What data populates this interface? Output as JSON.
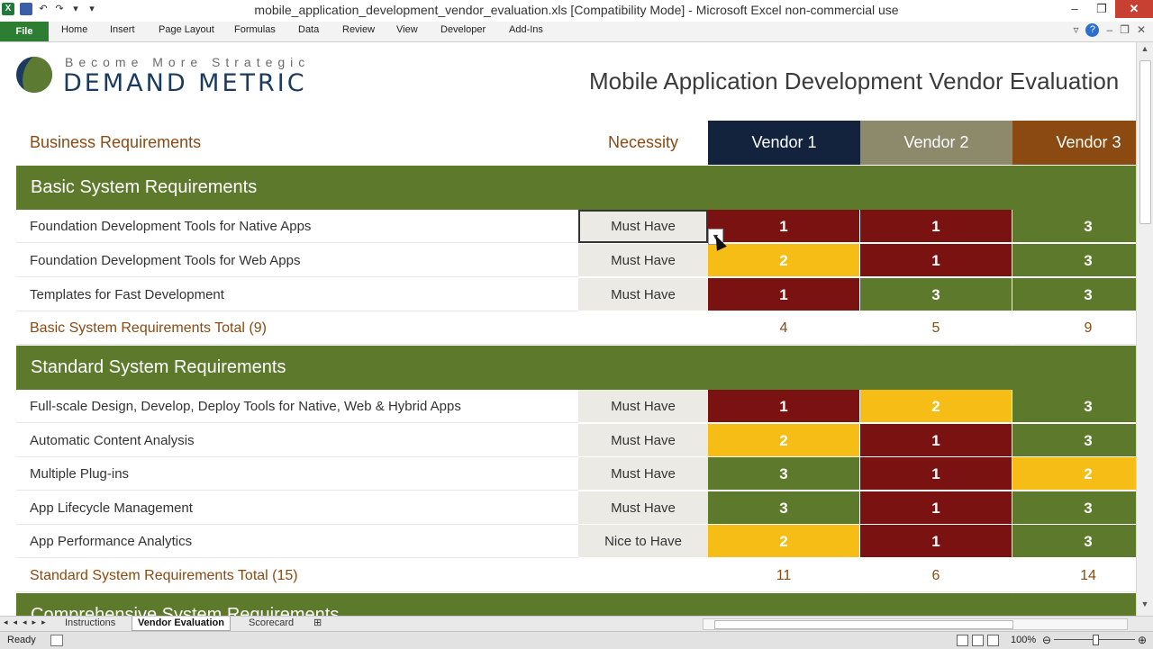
{
  "window": {
    "title": "mobile_application_development_vendor_evaluation.xls  [Compatibility Mode]  -  Microsoft Excel non-commercial use",
    "controls": {
      "minimize": "–",
      "restore": "❐",
      "close": "✕"
    }
  },
  "ribbon": {
    "file_label": "File",
    "tabs": [
      "Home",
      "Insert",
      "Page Layout",
      "Formulas",
      "Data",
      "Review",
      "View",
      "Developer",
      "Add-Ins"
    ]
  },
  "logo": {
    "tagline": "Become More Strategic",
    "name": "DEMAND METRIC"
  },
  "sheet_title": "Mobile Application Development Vendor Evaluation",
  "headers": {
    "requirements": "Business Requirements",
    "necessity": "Necessity",
    "vendors": [
      "Vendor 1",
      "Vendor 2",
      "Vendor 3"
    ]
  },
  "sections": [
    {
      "title": "Basic System Requirements",
      "rows": [
        {
          "req": "Foundation Development Tools for Native Apps",
          "necessity": "Must Have",
          "scores": [
            "1",
            "1",
            "3"
          ]
        },
        {
          "req": "Foundation Development Tools for Web Apps",
          "necessity": "Must Have",
          "scores": [
            "2",
            "1",
            "3"
          ]
        },
        {
          "req": "Templates for Fast Development",
          "necessity": "Must Have",
          "scores": [
            "1",
            "3",
            "3"
          ]
        }
      ],
      "total_label": "Basic System Requirements Total (9)",
      "totals": [
        "4",
        "5",
        "9"
      ]
    },
    {
      "title": "Standard System Requirements",
      "rows": [
        {
          "req": "Full-scale Design, Develop, Deploy Tools for Native, Web & Hybrid Apps",
          "necessity": "Must Have",
          "scores": [
            "1",
            "2",
            "3"
          ]
        },
        {
          "req": "Automatic Content Analysis",
          "necessity": "Must Have",
          "scores": [
            "2",
            "1",
            "3"
          ]
        },
        {
          "req": "Multiple Plug-ins",
          "necessity": "Must Have",
          "scores": [
            "3",
            "1",
            "2"
          ]
        },
        {
          "req": "App Lifecycle Management",
          "necessity": "Must Have",
          "scores": [
            "3",
            "1",
            "3"
          ]
        },
        {
          "req": "App Performance Analytics",
          "necessity": "Nice to Have",
          "scores": [
            "2",
            "1",
            "3"
          ]
        }
      ],
      "total_label": "Standard System Requirements Total (15)",
      "totals": [
        "11",
        "6",
        "14"
      ]
    },
    {
      "title": "Comprehensive System Requirements"
    }
  ],
  "sheet_tabs": [
    "Instructions",
    "Vendor Evaluation",
    "Scorecard"
  ],
  "status": {
    "text": "Ready",
    "zoom": "100%"
  },
  "colors": {
    "score_1": "#7b1212",
    "score_2": "#f7bd17",
    "score_3": "#5d7a2c",
    "section": "#5d7a2c",
    "vendor1": "#13233d",
    "vendor2": "#8c8a6a",
    "vendor3": "#8a4a12"
  }
}
